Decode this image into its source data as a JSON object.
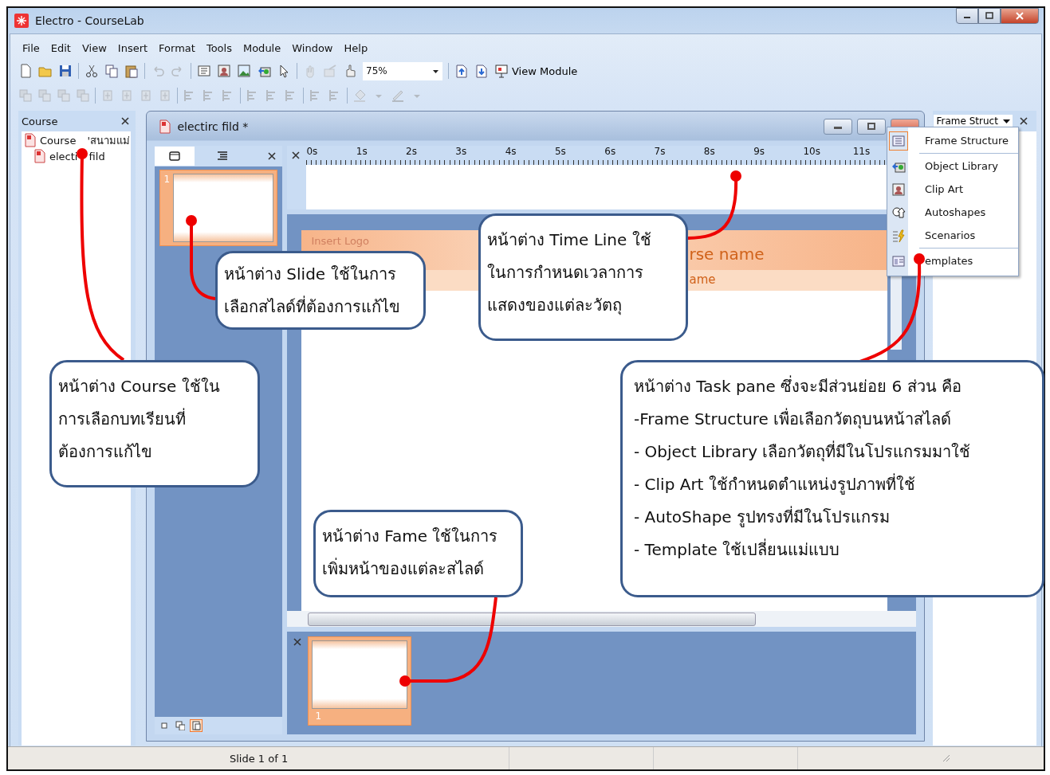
{
  "window": {
    "title": "Electro - CourseLab"
  },
  "menu": [
    "File",
    "Edit",
    "View",
    "Insert",
    "Format",
    "Tools",
    "Module",
    "Window",
    "Help"
  ],
  "toolbar": {
    "zoom": "75%",
    "view_module": "View Module"
  },
  "course_panel": {
    "title": "Course",
    "tree": [
      {
        "label": "Course 'สนามแม่",
        "children": [
          {
            "label": "electi fild"
          }
        ]
      }
    ]
  },
  "document": {
    "title": "electirc fild *",
    "slide_tabs": [
      {
        "selected": true
      },
      {
        "selected": false
      }
    ],
    "slides": [
      {
        "number": "1",
        "selected": true
      }
    ],
    "view_buttons": [
      {
        "selected": false
      },
      {
        "selected": false
      },
      {
        "selected": true
      }
    ],
    "timeline": {
      "ticks": [
        "0s",
        "1s",
        "2s",
        "3s",
        "4s",
        "5s",
        "6s",
        "7s",
        "8s",
        "9s",
        "10s",
        "11s"
      ]
    },
    "slide": {
      "logo": "Insert Logo",
      "title": "rse name",
      "subtitle": "ame"
    },
    "frames": [
      {
        "number": "1",
        "selected": true
      }
    ]
  },
  "task_pane": {
    "dropdown": "Frame Struct",
    "groups": [
      {
        "items": [
          {
            "label": "Frame Structure",
            "selected": true
          }
        ]
      },
      {
        "items": [
          {
            "label": "Object Library",
            "selected": false
          },
          {
            "label": "Clip Art",
            "selected": false
          },
          {
            "label": "Autoshapes",
            "selected": false
          },
          {
            "label": "Scenarios",
            "selected": false
          }
        ]
      },
      {
        "items": [
          {
            "label": "emplates",
            "selected": false
          }
        ]
      }
    ]
  },
  "status_bar": {
    "text": "Slide 1 of 1"
  },
  "callouts": [
    {
      "text": "หน้าต่าง Course ใช้ใน\nการเลือกบทเรียนที่\nต้องการแก้ไข"
    },
    {
      "text": "หน้าต่าง Slide ใช้ในการ\nเลือกสไลด์ที่ต้องการแก้ไข"
    },
    {
      "text": "หน้าต่าง Time Line ใช้\nในการกำหนดเวลาการ\nแสดงของแต่ละวัตถุ"
    },
    {
      "text": "หน้าต่าง Task pane ซึ่งจะมีส่วนย่อย 6 ส่วน คือ\n-Frame Structure เพื่อเลือกวัตถุบนหน้าสไลด์\n- Object Library เลือกวัตถุที่มีในโปรแกรมมาใช้\n- Clip Art ใช้กำหนดตำแหน่งรูปภาพที่ใช้\n- AutoShape รูปทรงที่มีในโปรแกรม\n- Template ใช้เปลี่ยนแม่แบบ"
    },
    {
      "text": "หน้าต่าง Fame ใช้ในการ\nเพิ่มหน้าของแต่ละสไลด์"
    }
  ]
}
